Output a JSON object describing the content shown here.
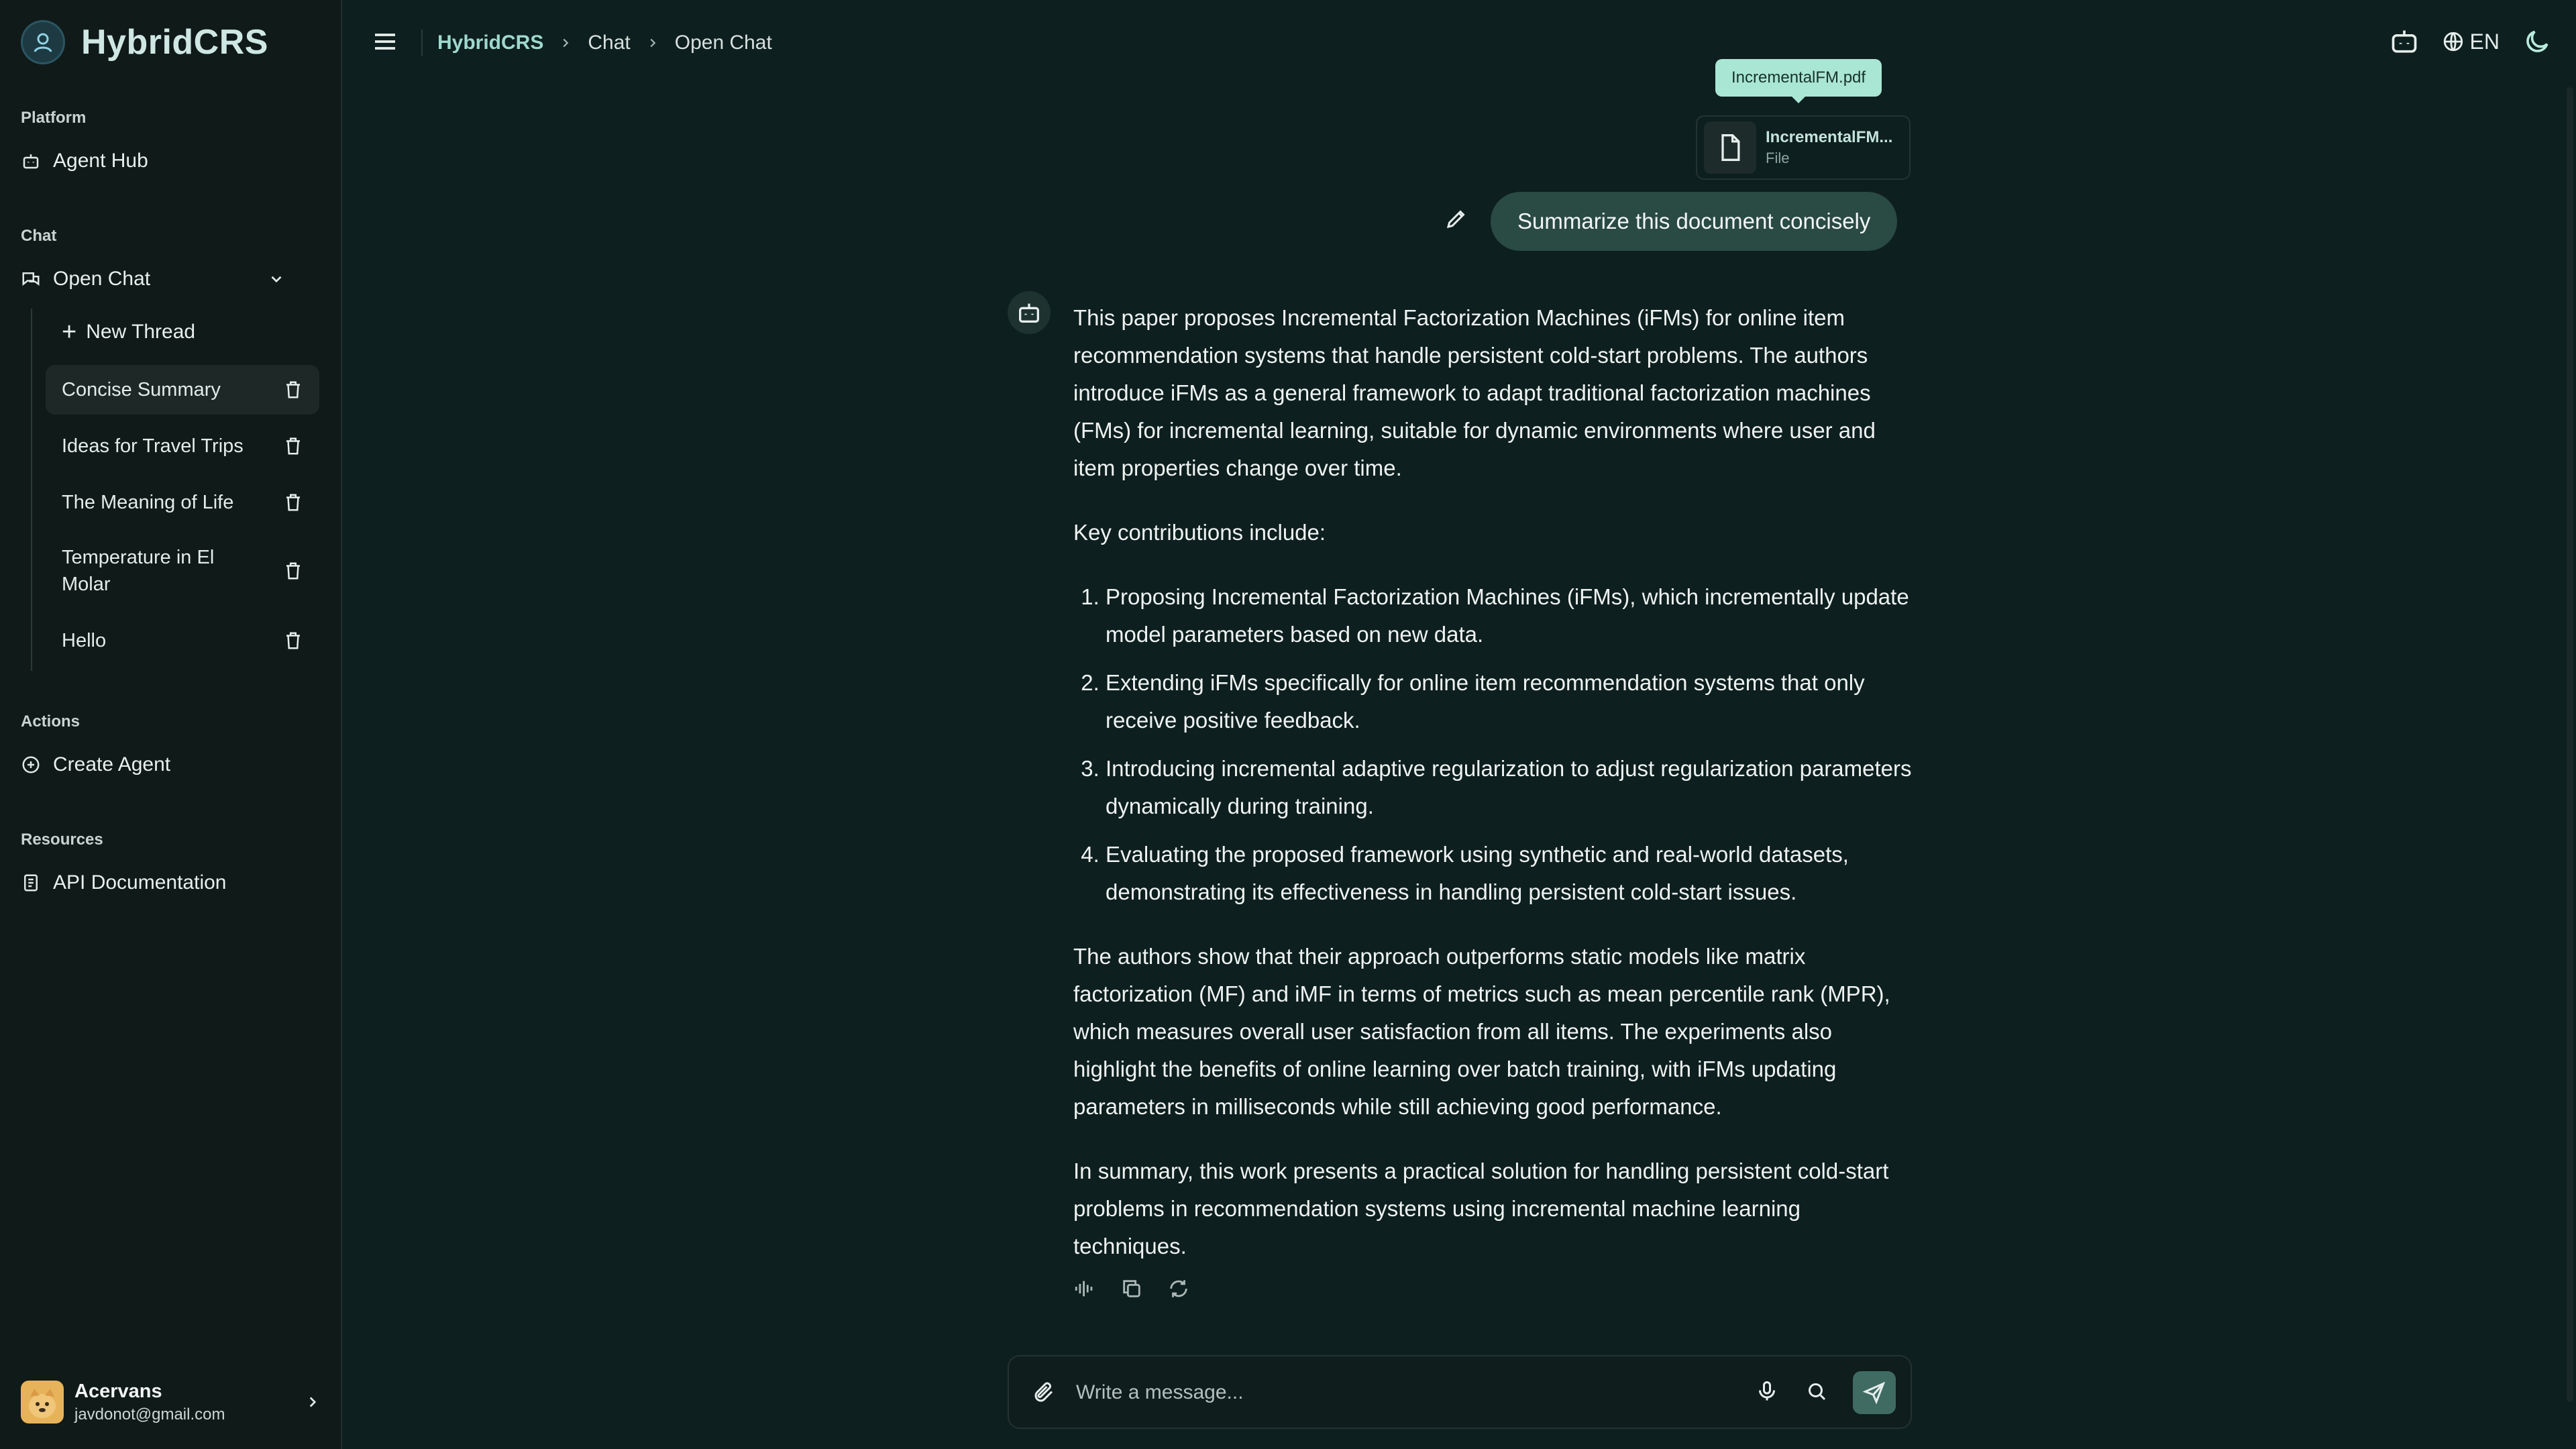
{
  "app": {
    "name": "HybridCRS"
  },
  "sidebar": {
    "sections": {
      "platform": "Platform",
      "chat": "Chat",
      "actions": "Actions",
      "resources": "Resources"
    },
    "agent_hub": "Agent Hub",
    "open_chat": "Open Chat",
    "new_thread": "New Thread",
    "threads": [
      {
        "label": "Concise Summary",
        "active": true
      },
      {
        "label": "Ideas for Travel Trips"
      },
      {
        "label": "The Meaning of Life"
      },
      {
        "label": "Temperature in El Molar"
      },
      {
        "label": "Hello"
      }
    ],
    "create_agent": "Create Agent",
    "api_docs": "API Documentation",
    "user": {
      "name": "Acervans",
      "email": "javdonot@gmail.com"
    }
  },
  "header": {
    "breadcrumb": [
      "HybridCRS",
      "Chat",
      "Open Chat"
    ],
    "language": "EN"
  },
  "conversation": {
    "attachment": {
      "tooltip": "IncrementalFM.pdf",
      "name": "IncrementalFM...",
      "type": "File"
    },
    "user_message": "Summarize this document concisely",
    "answer": {
      "intro": "This paper proposes Incremental Factorization Machines (iFMs) for online item recommendation systems that handle persistent cold-start problems. The authors introduce iFMs as a general framework to adapt traditional factorization machines (FMs) for incremental learning, suitable for dynamic environments where user and item properties change over time.",
      "key_heading": "Key contributions include:",
      "contributions": [
        "Proposing Incremental Factorization Machines (iFMs), which incrementally update model parameters based on new data.",
        "Extending iFMs specifically for online item recommendation systems that only receive positive feedback.",
        "Introducing incremental adaptive regularization to adjust regularization parameters dynamically during training.",
        "Evaluating the proposed framework using synthetic and real-world datasets, demonstrating its effectiveness in handling persistent cold-start issues."
      ],
      "results": "The authors show that their approach outperforms static models like matrix factorization (MF) and iMF in terms of metrics such as mean percentile rank (MPR), which measures overall user satisfaction from all items. The experiments also highlight the benefits of online learning over batch training, with iFMs updating parameters in milliseconds while still achieving good performance.",
      "summary": "In summary, this work presents a practical solution for handling persistent cold-start problems in recommendation systems using incremental machine learning techniques."
    }
  },
  "composer": {
    "placeholder": "Write a message..."
  },
  "colors": {
    "background": "#0d1f1e",
    "sidebar": "#101a19",
    "accent": "#9fd9cd",
    "bubble": "#2a4a44"
  }
}
